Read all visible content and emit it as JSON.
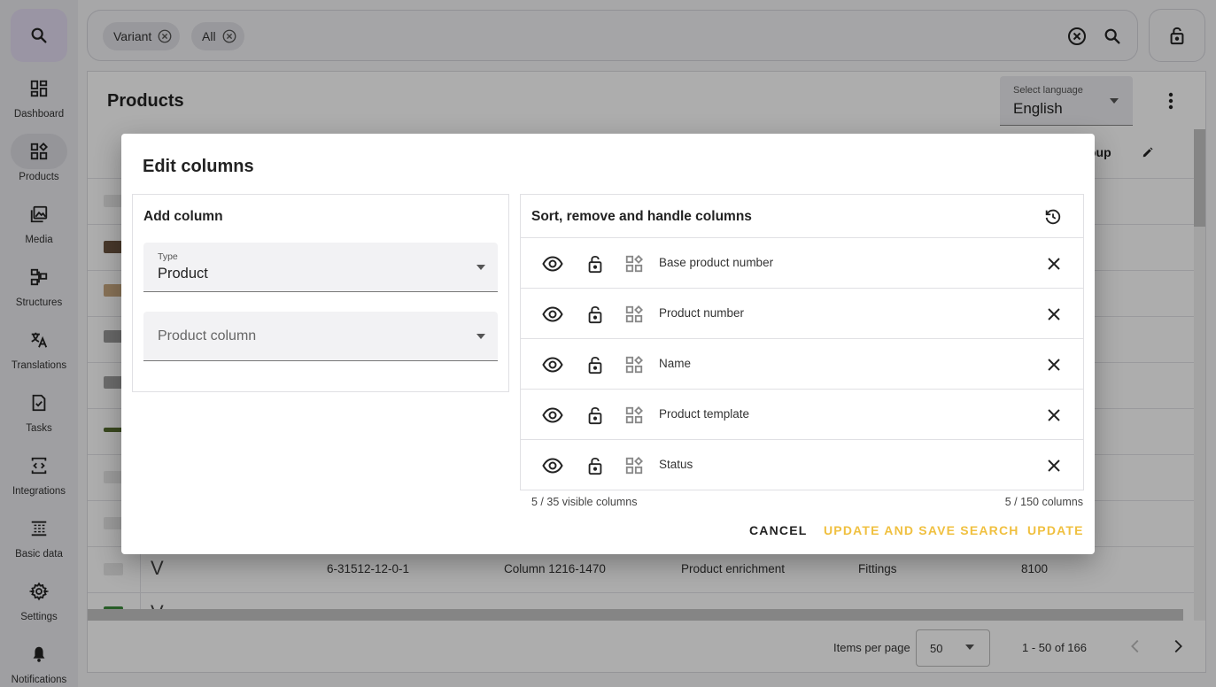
{
  "sidebar": {
    "items": [
      {
        "label": "Dashboard",
        "icon": "dashboard-icon"
      },
      {
        "label": "Products",
        "icon": "products-icon"
      },
      {
        "label": "Media",
        "icon": "media-icon"
      },
      {
        "label": "Structures",
        "icon": "structures-icon"
      },
      {
        "label": "Translations",
        "icon": "translate-icon"
      },
      {
        "label": "Tasks",
        "icon": "tasks-icon"
      },
      {
        "label": "Integrations",
        "icon": "integrations-icon"
      },
      {
        "label": "Basic data",
        "icon": "basic-data-icon"
      },
      {
        "label": "Settings",
        "icon": "gear-icon"
      },
      {
        "label": "Notifications",
        "icon": "bell-icon"
      }
    ],
    "active": "Products"
  },
  "search": {
    "chips": [
      "Variant",
      "All"
    ]
  },
  "main": {
    "title": "Products",
    "language": {
      "label": "Select language",
      "value": "English"
    },
    "header_fragment": "oup",
    "visible_row": {
      "type": "V",
      "number": "6-31512-12-0-1",
      "column": "Column 1216-1470",
      "template": "Product enrichment",
      "group": "Fittings",
      "code": "8100"
    },
    "partial_row": {
      "type": "V"
    },
    "footer": {
      "items_per_page_label": "Items per page",
      "items_per_page": "50",
      "range": "1 - 50 of 166"
    }
  },
  "dialog": {
    "title": "Edit columns",
    "add_column": {
      "title": "Add column",
      "type_label": "Type",
      "type_value": "Product",
      "product_column_placeholder": "Product column"
    },
    "sort_panel": {
      "title": "Sort, remove and handle columns",
      "columns": [
        "Base product number",
        "Product number",
        "Name",
        "Product template",
        "Status"
      ]
    },
    "visible_count": "5 / 35  visible columns",
    "total_count": "5 / 150  columns",
    "buttons": {
      "cancel": "CANCEL",
      "update_save": "UPDATE AND SAVE SEARCH",
      "update": "UPDATE"
    },
    "accent_color": "#f0c040"
  }
}
